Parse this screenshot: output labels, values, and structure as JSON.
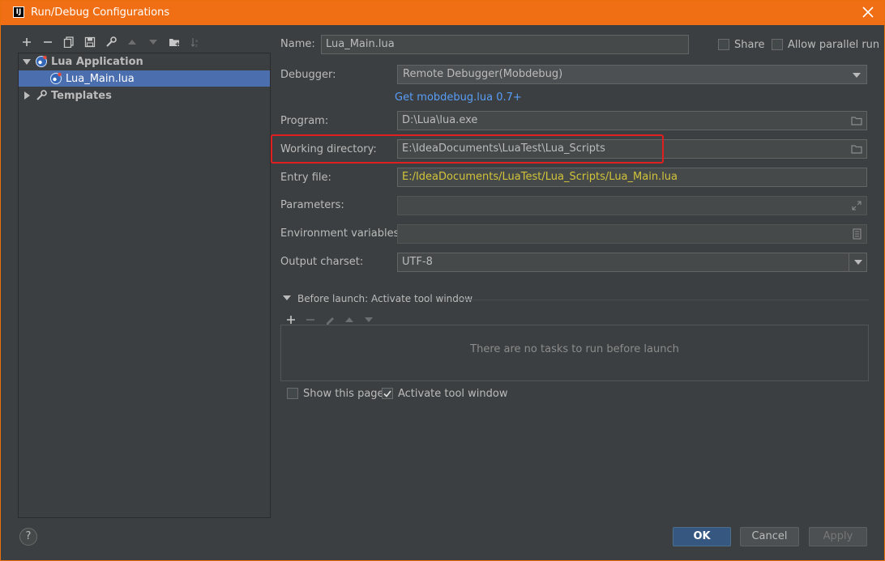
{
  "window": {
    "title": "Run/Debug Configurations",
    "app_icon_text": "IJ"
  },
  "toolbar": {
    "items": [
      {
        "name": "add-icon",
        "enabled": true
      },
      {
        "name": "remove-icon",
        "enabled": true
      },
      {
        "name": "copy-icon",
        "enabled": true
      },
      {
        "name": "save-icon",
        "enabled": true
      },
      {
        "name": "wrench-icon",
        "enabled": true
      },
      {
        "name": "move-up-icon",
        "enabled": false
      },
      {
        "name": "move-down-icon",
        "enabled": false
      },
      {
        "name": "folder-icon",
        "enabled": true
      },
      {
        "name": "sort-icon",
        "enabled": false
      }
    ]
  },
  "tree": {
    "lua_application": "Lua Application",
    "lua_main": "Lua_Main.lua",
    "templates": "Templates"
  },
  "form": {
    "name_label": "Name:",
    "name_value": "Lua_Main.lua",
    "share_label": "Share",
    "allow_parallel_label": "Allow parallel run",
    "debugger_label": "Debugger:",
    "debugger_value": "Remote Debugger(Mobdebug)",
    "get_link": "Get mobdebug.lua 0.7+",
    "program_label": "Program:",
    "program_value": "D:\\Lua\\lua.exe",
    "working_dir_label": "Working directory:",
    "working_dir_value": "E:\\IdeaDocuments\\LuaTest\\Lua_Scripts",
    "entry_file_label": "Entry file:",
    "entry_file_value": "E:/IdeaDocuments/LuaTest/Lua_Scripts/Lua_Main.lua",
    "parameters_label": "Parameters:",
    "parameters_value": "",
    "env_label": "Environment variables:",
    "env_value": "",
    "charset_label": "Output charset:",
    "charset_value": "UTF-8"
  },
  "before_launch": {
    "title": "Before launch: Activate tool window",
    "empty_text": "There are no tasks to run before launch"
  },
  "options": {
    "show_page_label": "Show this page",
    "show_page_checked": false,
    "activate_label": "Activate tool window",
    "activate_checked": true
  },
  "buttons": {
    "help": "?",
    "ok": "OK",
    "cancel": "Cancel",
    "apply": "Apply"
  },
  "colors": {
    "title_bar": "#f06e14",
    "selection": "#4b6eaf",
    "link": "#589df6",
    "entry_file_text": "#d2c43a",
    "highlight_box": "#e02020"
  }
}
